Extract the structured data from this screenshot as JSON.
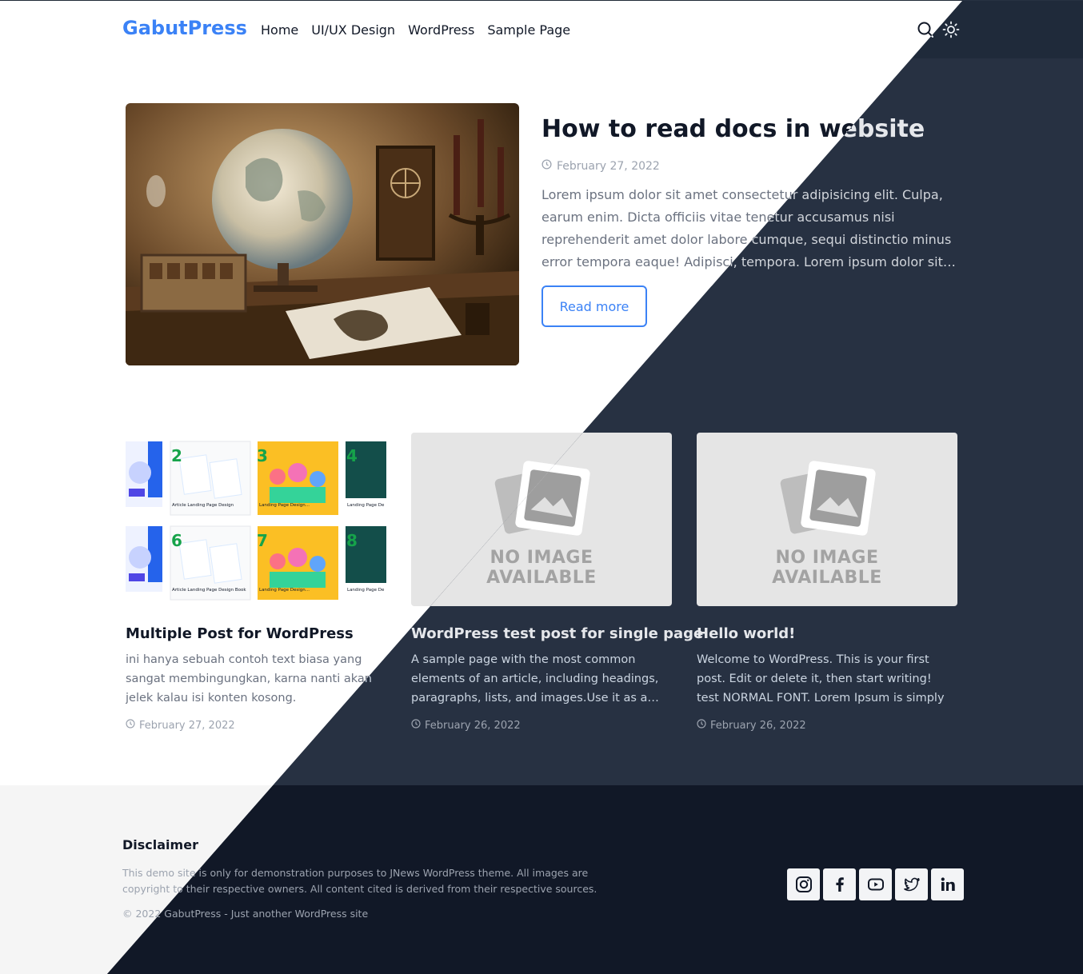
{
  "site": {
    "logo": "GabutPress",
    "accent": "#3b82f6",
    "dark_bg": "#273142"
  },
  "nav": {
    "items": [
      {
        "label": "Home"
      },
      {
        "label": "UI/UX Design"
      },
      {
        "label": "WordPress"
      },
      {
        "label": "Sample Page"
      }
    ],
    "icons": [
      "search-icon",
      "theme-toggle-icon"
    ]
  },
  "hero": {
    "title": "How to read docs in website",
    "date": "February 27, 2022",
    "excerpt": "Lorem ipsum dolor sit amet consectetur adipisicing elit. Culpa, earum enim. Dicta officiis vitae tenetur accusamus nisi reprehenderit amet dolor labore cumque, sequi distinctio minus error tempora eaque! Adipisci, tempora. Lorem ipsum dolor sit…",
    "read_more": "Read more"
  },
  "posts": [
    {
      "title": "Multiple Post for WordPress",
      "excerpt": "ini hanya sebuah contoh text biasa yang sangat membingungkan, karna nanti akan jelek kalau isi konten kosong.",
      "date": "February 27, 2022"
    },
    {
      "title": "WordPress test post for single page",
      "excerpt": "A sample page with the most common elements of an article, including headings, paragraphs, lists, and images.Use it as a…",
      "date": "February 26, 2022",
      "placeholder": [
        "NO IMAGE",
        "AVAILABLE"
      ]
    },
    {
      "title": "Hello world!",
      "excerpt": "Welcome to WordPress. This is your first post. Edit or delete it, then start writing! test NORMAL FONT. Lorem Ipsum is simply dummy text of…",
      "date": "February 26, 2022",
      "placeholder": [
        "NO IMAGE",
        "AVAILABLE"
      ]
    }
  ],
  "thumbnail_numbers": [
    "2",
    "3",
    "4",
    "6",
    "7",
    "8"
  ],
  "thumbnail_captions": [
    "Article Landing Page Design",
    "Landing Page Design...",
    "Landing Page De",
    "Article Landing Page Design Book",
    "Landing Page Design...",
    "Landing Page De"
  ],
  "footer": {
    "title": "Disclaimer",
    "text": "This demo site is only for demonstration purposes to JNews WordPress theme. All images are copyright to their respective owners. All content cited is derived from their respective sources.",
    "copyright": "© 2022 GabutPress - Just another WordPress site",
    "socials": [
      "instagram-icon",
      "facebook-icon",
      "youtube-icon",
      "twitter-icon",
      "linkedin-icon"
    ]
  }
}
